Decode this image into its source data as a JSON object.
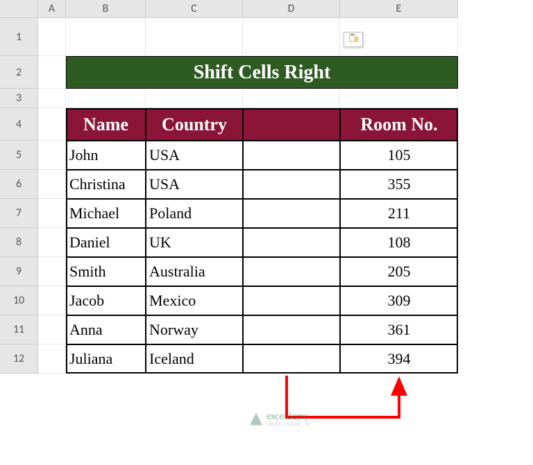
{
  "columns": [
    {
      "letter": "A",
      "width": 40
    },
    {
      "letter": "B",
      "width": 115
    },
    {
      "letter": "C",
      "width": 140
    },
    {
      "letter": "D",
      "width": 140
    },
    {
      "letter": "E",
      "width": 170
    }
  ],
  "rows": [
    {
      "num": "1",
      "height": 55
    },
    {
      "num": "2",
      "height": 47
    },
    {
      "num": "3",
      "height": 28
    },
    {
      "num": "4",
      "height": 47
    },
    {
      "num": "5",
      "height": 42
    },
    {
      "num": "6",
      "height": 42
    },
    {
      "num": "7",
      "height": 42
    },
    {
      "num": "8",
      "height": 42
    },
    {
      "num": "9",
      "height": 42
    },
    {
      "num": "10",
      "height": 42
    },
    {
      "num": "11",
      "height": 42
    },
    {
      "num": "12",
      "height": 42
    }
  ],
  "title": "Shift Cells Right",
  "headers": {
    "name": "Name",
    "country": "Country",
    "blank": "",
    "room": "Room No."
  },
  "data_rows": [
    {
      "name": "John",
      "country": "USA",
      "room": "105"
    },
    {
      "name": "Christina",
      "country": "USA",
      "room": "355"
    },
    {
      "name": "Michael",
      "country": "Poland",
      "room": "211"
    },
    {
      "name": "Daniel",
      "country": "UK",
      "room": "108"
    },
    {
      "name": "Smith",
      "country": "Australia",
      "room": "205"
    },
    {
      "name": "Jacob",
      "country": "Mexico",
      "room": "309"
    },
    {
      "name": "Anna",
      "country": "Norway",
      "room": "361"
    },
    {
      "name": "Juliana",
      "country": "Iceland",
      "room": "394"
    }
  ],
  "watermark": {
    "main": "exceldemy",
    "sub": "EXCEL · DATA · BI"
  }
}
